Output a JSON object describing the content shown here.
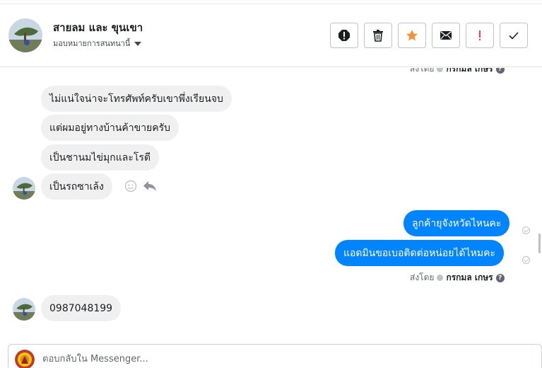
{
  "header": {
    "contact_name": "สายลม และ ขุนเขา",
    "assign_label": "มอบหมายการสนทนานี้",
    "actions": [
      {
        "icon": "alert-circle-icon",
        "color": "#1c1e21"
      },
      {
        "icon": "trash-icon",
        "color": "#1c1e21"
      },
      {
        "icon": "star-icon",
        "color": "#f7923b"
      },
      {
        "icon": "envelope-icon",
        "color": "#1c1e21"
      },
      {
        "icon": "exclamation-icon",
        "color": "#fa383e"
      },
      {
        "icon": "checkmark-icon",
        "color": "#1c1e21"
      }
    ]
  },
  "thread": {
    "top_sent_meta": {
      "prefix": "ส่งโดย",
      "sender": "กรกมล เกษร"
    },
    "incoming_group_1": [
      "ไม่แน่ใจน่าจะโทรศัพท์ครับเขาพึ่งเรียนจบ",
      "แต่ผมอยู่ทางบ้านค้าขายครับ",
      "เป็นชานมไข่มุกและโรตี",
      "เป็นรถซาเล้ง"
    ],
    "outgoing": [
      "ลูกค้ายุจังหวัดไหนคะ",
      "แอดมินขอเบอติดต่อหน่อยได้ไหมคะ"
    ],
    "sent_meta": {
      "prefix": "ส่งโดย",
      "sender": "กรกมล เกษร"
    },
    "incoming_group_2": [
      "0987048199"
    ]
  },
  "composer": {
    "placeholder": "ตอบกลับใน Messenger..."
  },
  "colors": {
    "outgoing_bubble": "#0084ff",
    "incoming_bubble": "#f0f0f0",
    "star": "#f7923b",
    "exclamation": "#fa383e"
  }
}
